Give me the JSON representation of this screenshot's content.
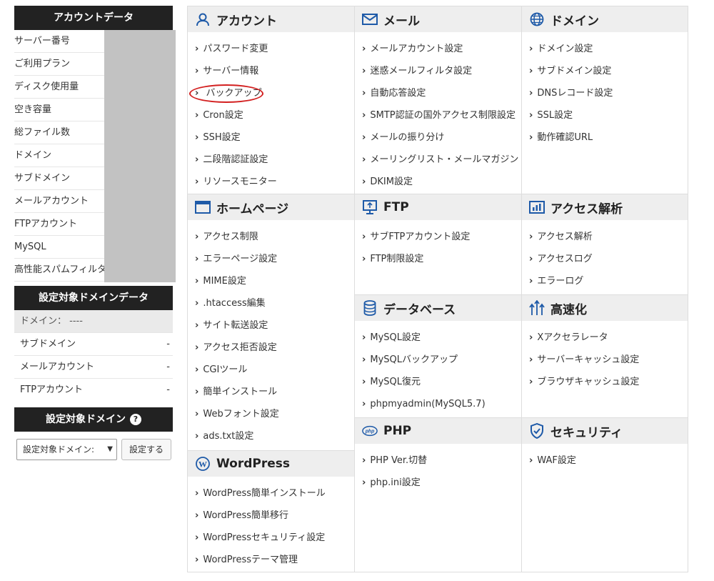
{
  "sidebar": {
    "account_header": "アカウントデータ",
    "account_rows": [
      "サーバー番号",
      "ご利用プラン",
      "ディスク使用量",
      "空き容量",
      "総ファイル数",
      "ドメイン",
      "サブドメイン",
      "メールアカウント",
      "FTPアカウント",
      "MySQL",
      "高性能スパムフィルタ"
    ],
    "domain_header": "設定対象ドメインデータ",
    "domain_first": "ドメイン： ----",
    "domain_rows": [
      {
        "label": "サブドメイン",
        "value": "-"
      },
      {
        "label": "メールアカウント",
        "value": "-"
      },
      {
        "label": "FTPアカウント",
        "value": "-"
      }
    ],
    "select_header": "設定対象ドメイン",
    "select_value": "設定対象ドメイン:",
    "set_button": "設定する"
  },
  "sections": {
    "account": {
      "title": "アカウント",
      "icon": "user-icon",
      "items": [
        "パスワード変更",
        "サーバー情報",
        "バックアップ",
        "Cron設定",
        "SSH設定",
        "二段階認証設定",
        "リソースモニター"
      ]
    },
    "mail": {
      "title": "メール",
      "icon": "mail-icon",
      "items": [
        "メールアカウント設定",
        "迷惑メールフィルタ設定",
        "自動応答設定",
        "SMTP認証の国外アクセス制限設定",
        "メールの振り分け",
        "メーリングリスト・メールマガジン",
        "DKIM設定"
      ]
    },
    "domain": {
      "title": "ドメイン",
      "icon": "globe-icon",
      "items": [
        "ドメイン設定",
        "サブドメイン設定",
        "DNSレコード設定",
        "SSL設定",
        "動作確認URL"
      ]
    },
    "homepage": {
      "title": "ホームページ",
      "icon": "browser-window-icon",
      "items": [
        "アクセス制限",
        "エラーページ設定",
        "MIME設定",
        ".htaccess編集",
        "サイト転送設定",
        "アクセス拒否設定",
        "CGIツール",
        "簡単インストール",
        "Webフォント設定",
        "ads.txt設定"
      ]
    },
    "ftp": {
      "title": "FTP",
      "icon": "monitor-upload-icon",
      "items": [
        "サブFTPアカウント設定",
        "FTP制限設定"
      ]
    },
    "analytics": {
      "title": "アクセス解析",
      "icon": "bar-chart-icon",
      "items": [
        "アクセス解析",
        "アクセスログ",
        "エラーログ"
      ]
    },
    "database": {
      "title": "データベース",
      "icon": "database-icon",
      "items": [
        "MySQL設定",
        "MySQLバックアップ",
        "MySQL復元",
        "phpmyadmin(MySQL5.7)"
      ]
    },
    "speed": {
      "title": "高速化",
      "icon": "speed-arrows-icon",
      "items": [
        "Xアクセラレータ",
        "サーバーキャッシュ設定",
        "ブラウザキャッシュ設定"
      ]
    },
    "wordpress": {
      "title": "WordPress",
      "icon": "wordpress-icon",
      "items": [
        "WordPress簡単インストール",
        "WordPress簡単移行",
        "WordPressセキュリティ設定",
        "WordPressテーマ管理"
      ]
    },
    "php": {
      "title": "PHP",
      "icon": "php-icon",
      "items": [
        "PHP Ver.切替",
        "php.ini設定"
      ]
    },
    "security": {
      "title": "セキュリティ",
      "icon": "shield-icon",
      "items": [
        "WAF設定"
      ]
    }
  },
  "colors": {
    "accent_icon": "#1e5aa8",
    "highlight_oval": "#d32020",
    "header_dark": "#222222"
  }
}
